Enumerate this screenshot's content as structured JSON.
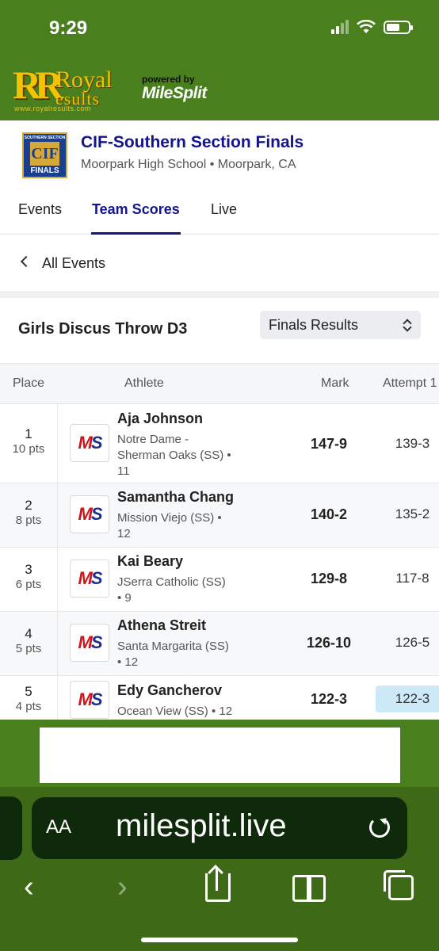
{
  "status": {
    "time": "9:29"
  },
  "brand": {
    "logo_rr": "RR",
    "logo_royal": "Royal",
    "logo_results": "esults",
    "logo_url": "www.royalresults.com",
    "powered_by": "powered by",
    "milesplit": "MileSplit"
  },
  "meet": {
    "logo_top": "SOUTHERN SECTION",
    "logo_mid": "CIF",
    "logo_bottom": "FINALS",
    "title": "CIF-Southern Section Finals",
    "location": "Moorpark High School • Moorpark, CA"
  },
  "tabs": [
    {
      "label": "Events"
    },
    {
      "label": "Team Scores"
    },
    {
      "label": "Live"
    }
  ],
  "back": {
    "label": "All Events"
  },
  "event": {
    "title": "Girls Discus Throw D3",
    "select_value": "Finals Results"
  },
  "table": {
    "headers": {
      "place": "Place",
      "athlete": "Athlete",
      "mark": "Mark",
      "attempt": "Attempt 1"
    },
    "rows": [
      {
        "place": "1",
        "pts": "10 pts",
        "name": "Aja Johnson",
        "team_lines": [
          "Notre Dame -",
          "Sherman Oaks (SS) •",
          "11"
        ],
        "mark": "147-9",
        "attempt": "139-3"
      },
      {
        "place": "2",
        "pts": "8 pts",
        "name": "Samantha Chang",
        "team_lines": [
          "Mission Viejo (SS) •",
          "12"
        ],
        "mark": "140-2",
        "attempt": "135-2"
      },
      {
        "place": "3",
        "pts": "6 pts",
        "name": "Kai Beary",
        "team_lines": [
          "JSerra Catholic (SS)",
          "• 9"
        ],
        "mark": "129-8",
        "attempt": "117-8"
      },
      {
        "place": "4",
        "pts": "5 pts",
        "name": "Athena Streit",
        "team_lines": [
          "Santa Margarita (SS)",
          "• 12"
        ],
        "mark": "126-10",
        "attempt": "126-5"
      },
      {
        "place": "5",
        "pts": "4 pts",
        "name": "Edy Gancherov",
        "team_lines": [
          "Ocean View (SS) • 12"
        ],
        "mark": "122-3",
        "attempt": "122-3"
      }
    ]
  },
  "ms_logo": {
    "m": "M",
    "s": "S"
  },
  "browser": {
    "aa": "AA",
    "url": "milesplit.live",
    "back_glyph": "‹",
    "forward_glyph": "›"
  },
  "colors": {
    "header_green": "#4a7f1e",
    "accent_navy": "#14148c",
    "highlight": "#cde9f7"
  }
}
